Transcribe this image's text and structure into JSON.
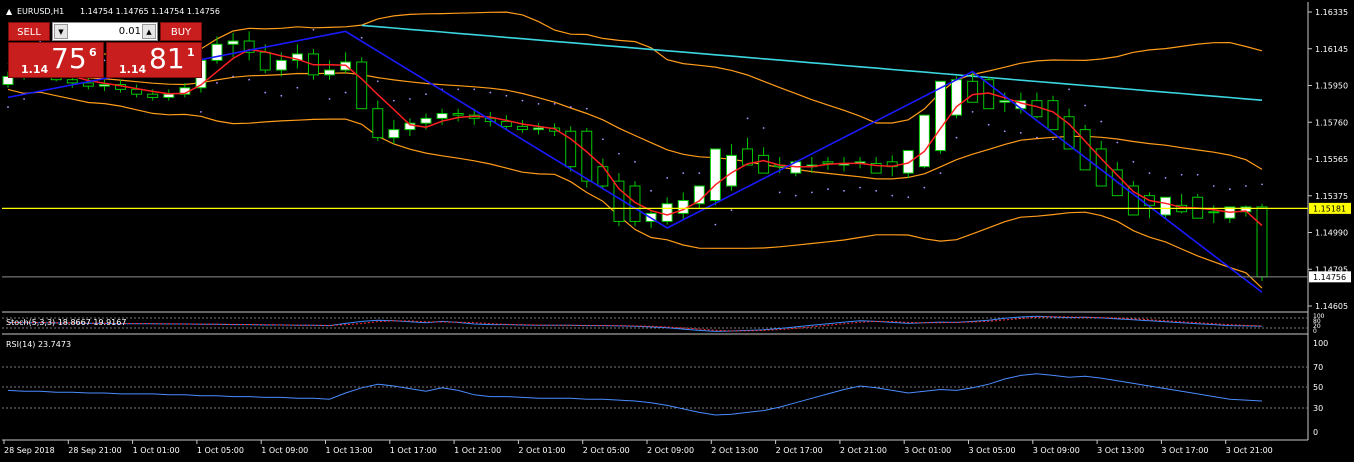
{
  "header": {
    "symbol_timeframe": "EURUSD,H1",
    "ohlc": "1.14754 1.14765 1.14754 1.14756"
  },
  "trade_panel": {
    "sell_label": "SELL",
    "buy_label": "BUY",
    "lot_value": "0.01",
    "sell_price": {
      "prefix": "1.14",
      "big": "75",
      "pip": "6"
    },
    "buy_price": {
      "prefix": "1.14",
      "big": "81",
      "pip": "1"
    }
  },
  "price_axis": {
    "labels": [
      "1.16335",
      "1.16145",
      "1.15950",
      "1.15760",
      "1.15565",
      "1.15375",
      "1.14990",
      "1.14795",
      "1.14605"
    ],
    "level_line_label": "1.15181",
    "current_price_label": "1.14756"
  },
  "stoch": {
    "label": "Stoch(5,3,3) 18.8667 19.9167",
    "axis_labels": [
      "100",
      "80",
      "20",
      "0"
    ]
  },
  "rsi": {
    "label": "RSI(14) 23.7473",
    "axis_labels": [
      "100",
      "70",
      "50",
      "30",
      "0"
    ]
  },
  "time_axis": {
    "labels": [
      "28 Sep 2018",
      "28 Sep 21:00",
      "1 Oct 01:00",
      "1 Oct 05:00",
      "1 Oct 09:00",
      "1 Oct 13:00",
      "1 Oct 17:00",
      "1 Oct 21:00",
      "2 Oct 01:00",
      "2 Oct 05:00",
      "2 Oct 09:00",
      "2 Oct 13:00",
      "2 Oct 17:00",
      "2 Oct 21:00",
      "3 Oct 01:00",
      "3 Oct 05:00",
      "3 Oct 09:00",
      "3 Oct 13:00",
      "3 Oct 17:00",
      "3 Oct 21:00"
    ]
  },
  "colors": {
    "background": "#000000",
    "bull_candle": "#ffffff",
    "bear_candle": "#000000",
    "candle_wick": "#00c800",
    "bollinger": "#ff9c1a",
    "ma_fast": "#ff2020",
    "ma_slow": "#3cd6e0",
    "zigzag": "#1a1aff",
    "sar": "#b090ff",
    "level_line": "#ffff00",
    "rsi_line": "#4a8cff",
    "trade_button": "#c81e1e"
  },
  "chart_data": {
    "type": "candlestick",
    "symbol": "EURUSD",
    "timeframe": "H1",
    "x": [
      "28 Sep 2018 16:00",
      "28 Sep 17:00",
      "28 Sep 18:00",
      "28 Sep 19:00",
      "28 Sep 20:00",
      "28 Sep 21:00",
      "28 Sep 22:00",
      "28 Sep 23:00",
      "1 Oct 00:00",
      "1 Oct 01:00",
      "1 Oct 02:00",
      "1 Oct 03:00",
      "1 Oct 04:00",
      "1 Oct 05:00",
      "1 Oct 06:00",
      "1 Oct 07:00",
      "1 Oct 08:00",
      "1 Oct 09:00",
      "1 Oct 10:00",
      "1 Oct 11:00",
      "1 Oct 12:00",
      "1 Oct 13:00",
      "1 Oct 14:00",
      "1 Oct 15:00",
      "1 Oct 16:00",
      "1 Oct 17:00",
      "1 Oct 18:00",
      "1 Oct 19:00",
      "1 Oct 20:00",
      "1 Oct 21:00",
      "1 Oct 22:00",
      "1 Oct 23:00",
      "2 Oct 00:00",
      "2 Oct 01:00",
      "2 Oct 02:00",
      "2 Oct 03:00",
      "2 Oct 04:00",
      "2 Oct 05:00",
      "2 Oct 06:00",
      "2 Oct 07:00",
      "2 Oct 08:00",
      "2 Oct 09:00",
      "2 Oct 10:00",
      "2 Oct 11:00",
      "2 Oct 12:00",
      "2 Oct 13:00",
      "2 Oct 14:00",
      "2 Oct 15:00",
      "2 Oct 16:00",
      "2 Oct 17:00",
      "2 Oct 18:00",
      "2 Oct 19:00",
      "2 Oct 20:00",
      "2 Oct 21:00",
      "2 Oct 22:00",
      "2 Oct 23:00",
      "3 Oct 00:00",
      "3 Oct 01:00",
      "3 Oct 02:00",
      "3 Oct 03:00",
      "3 Oct 04:00",
      "3 Oct 05:00",
      "3 Oct 06:00",
      "3 Oct 07:00",
      "3 Oct 08:00",
      "3 Oct 09:00",
      "3 Oct 10:00",
      "3 Oct 11:00",
      "3 Oct 12:00",
      "3 Oct 13:00",
      "3 Oct 14:00",
      "3 Oct 15:00",
      "3 Oct 16:00",
      "3 Oct 17:00",
      "3 Oct 18:00",
      "3 Oct 19:00",
      "3 Oct 20:00",
      "3 Oct 21:00",
      "3 Oct 22:00"
    ],
    "open": [
      1.1595,
      1.16,
      1.1605,
      1.1602,
      1.1598,
      1.1596,
      1.1594,
      1.1595,
      1.1592,
      1.1589,
      1.1587,
      1.1589,
      1.1593,
      1.161,
      1.162,
      1.1622,
      1.1615,
      1.1604,
      1.161,
      1.1614,
      1.1601,
      1.1604,
      1.1609,
      1.158,
      1.1562,
      1.1567,
      1.1571,
      1.1574,
      1.1577,
      1.1576,
      1.1574,
      1.1572,
      1.1569,
      1.1567,
      1.1568,
      1.1566,
      1.1566,
      1.1544,
      1.1535,
      1.1532,
      1.151,
      1.151,
      1.1515,
      1.1521,
      1.1523,
      1.1532,
      1.1555,
      1.1551,
      1.1545,
      1.154,
      1.1544,
      1.1547,
      1.1545,
      1.1546,
      1.1546,
      1.1547,
      1.154,
      1.1544,
      1.1554,
      1.1576,
      1.1597,
      1.1598,
      1.1584,
      1.158,
      1.1585,
      1.1585,
      1.1575,
      1.1567,
      1.1555,
      1.1542,
      1.1532,
      1.1526,
      1.1514,
      1.152,
      1.1525,
      1.1516,
      1.1512,
      1.1516,
      1.1519
    ],
    "high": [
      1.1603,
      1.1608,
      1.161,
      1.1607,
      1.1602,
      1.16,
      1.1598,
      1.1598,
      1.1595,
      1.1592,
      1.1592,
      1.1596,
      1.1612,
      1.1625,
      1.1627,
      1.1628,
      1.162,
      1.1615,
      1.162,
      1.1617,
      1.161,
      1.1615,
      1.1612,
      1.1585,
      1.1573,
      1.1574,
      1.1577,
      1.158,
      1.158,
      1.158,
      1.1578,
      1.1576,
      1.1573,
      1.1571,
      1.1571,
      1.1569,
      1.1568,
      1.1549,
      1.154,
      1.1535,
      1.1517,
      1.1525,
      1.1528,
      1.1528,
      1.1537,
      1.1558,
      1.1562,
      1.1556,
      1.155,
      1.1548,
      1.155,
      1.155,
      1.155,
      1.155,
      1.155,
      1.1551,
      1.1548,
      1.1556,
      1.158,
      1.16,
      1.1603,
      1.16,
      1.159,
      1.159,
      1.159,
      1.1588,
      1.158,
      1.157,
      1.156,
      1.1547,
      1.1535,
      1.1528,
      1.1525,
      1.1527,
      1.1527,
      1.152,
      1.1518,
      1.152,
      1.1521
    ],
    "low": [
      1.1593,
      1.1598,
      1.16,
      1.1597,
      1.1593,
      1.1592,
      1.1591,
      1.159,
      1.1587,
      1.1585,
      1.1585,
      1.1587,
      1.159,
      1.1608,
      1.1612,
      1.161,
      1.1602,
      1.16,
      1.1605,
      1.1598,
      1.1598,
      1.1602,
      1.158,
      1.156,
      1.1558,
      1.1563,
      1.1567,
      1.157,
      1.1572,
      1.157,
      1.1569,
      1.1567,
      1.1565,
      1.1564,
      1.1563,
      1.1541,
      1.1531,
      1.153,
      1.1507,
      1.1507,
      1.1506,
      1.1508,
      1.1511,
      1.1518,
      1.152,
      1.1529,
      1.1547,
      1.1543,
      1.154,
      1.1538,
      1.154,
      1.1542,
      1.1541,
      1.1543,
      1.1541,
      1.1538,
      1.1537,
      1.1543,
      1.1552,
      1.1574,
      1.159,
      1.1582,
      1.1578,
      1.1577,
      1.1574,
      1.1573,
      1.1565,
      1.1554,
      1.154,
      1.153,
      1.1523,
      1.1512,
      1.1512,
      1.1515,
      1.1513,
      1.1509,
      1.1509,
      1.1513,
      1.1473
    ],
    "close": [
      1.16,
      1.1605,
      1.1602,
      1.1598,
      1.1596,
      1.1594,
      1.1595,
      1.1592,
      1.1589,
      1.1587,
      1.1589,
      1.1593,
      1.161,
      1.162,
      1.1622,
      1.1615,
      1.1604,
      1.161,
      1.1614,
      1.1601,
      1.1604,
      1.1609,
      1.158,
      1.1562,
      1.1567,
      1.1571,
      1.1574,
      1.1577,
      1.1576,
      1.1574,
      1.1572,
      1.1569,
      1.1567,
      1.1568,
      1.1566,
      1.1544,
      1.1535,
      1.1532,
      1.151,
      1.151,
      1.1515,
      1.1521,
      1.1523,
      1.1532,
      1.1555,
      1.1551,
      1.1545,
      1.154,
      1.1544,
      1.1547,
      1.1545,
      1.1546,
      1.1546,
      1.1547,
      1.154,
      1.1544,
      1.1554,
      1.1576,
      1.1597,
      1.1598,
      1.1584,
      1.158,
      1.1585,
      1.1585,
      1.1575,
      1.1567,
      1.1555,
      1.1542,
      1.1532,
      1.1526,
      1.1514,
      1.152,
      1.1525,
      1.1516,
      1.1512,
      1.1516,
      1.1519,
      1.1519,
      1.14756
    ],
    "ylim": [
      1.1455,
      1.1645
    ],
    "level_line": 1.15181,
    "current_price": 1.14756,
    "rsi": [
      45,
      44,
      44,
      43,
      43,
      42,
      42,
      41,
      41,
      41,
      40,
      40,
      39,
      39,
      38,
      38,
      37,
      37,
      36,
      36,
      35,
      42,
      48,
      52,
      50,
      47,
      44,
      48,
      45,
      40,
      38,
      38,
      37,
      36,
      36,
      36,
      35,
      35,
      34,
      33,
      31,
      28,
      24,
      20,
      17,
      18,
      20,
      22,
      26,
      31,
      36,
      41,
      46,
      50,
      48,
      45,
      42,
      44,
      46,
      45,
      48,
      52,
      58,
      62,
      64,
      62,
      60,
      61,
      59,
      56,
      53,
      50,
      47,
      44,
      41,
      38,
      35,
      34,
      33,
      30,
      26,
      23.7
    ],
    "rsi_ylim": [
      0,
      100
    ]
  }
}
